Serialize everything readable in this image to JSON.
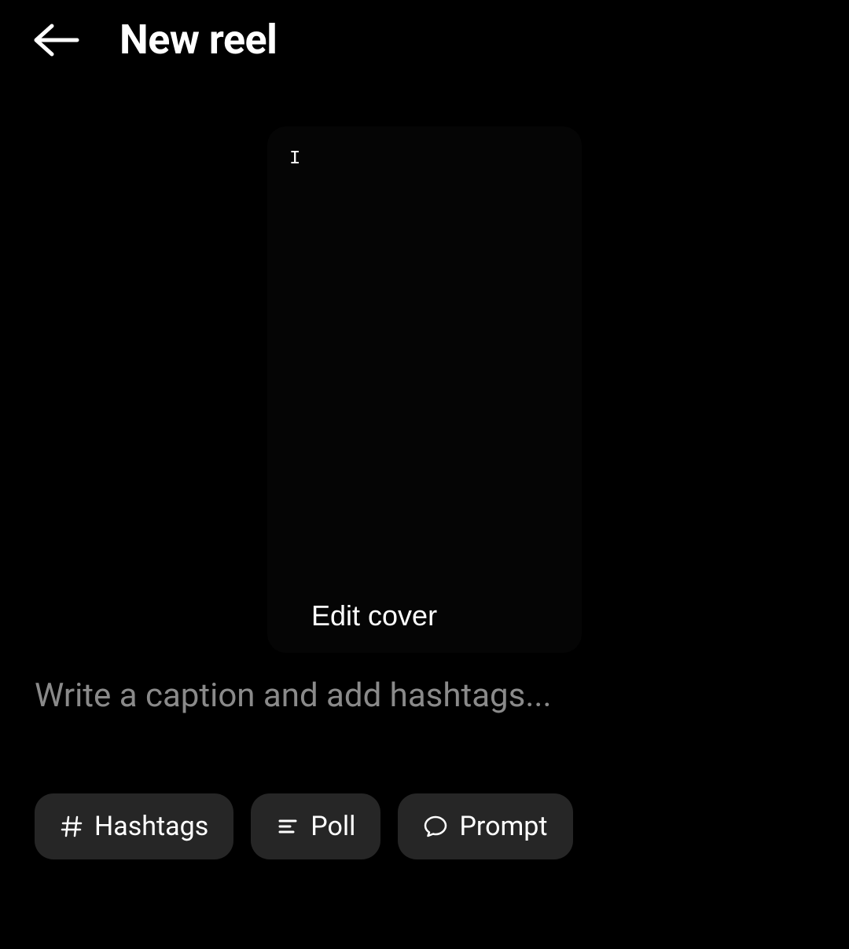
{
  "header": {
    "title": "New reel"
  },
  "preview": {
    "overlay_text": "I",
    "edit_cover_label": "Edit cover"
  },
  "caption": {
    "placeholder": "Write a caption and add hashtags...",
    "value": ""
  },
  "chips": {
    "hashtags_label": "Hashtags",
    "poll_label": "Poll",
    "prompt_label": "Prompt"
  }
}
